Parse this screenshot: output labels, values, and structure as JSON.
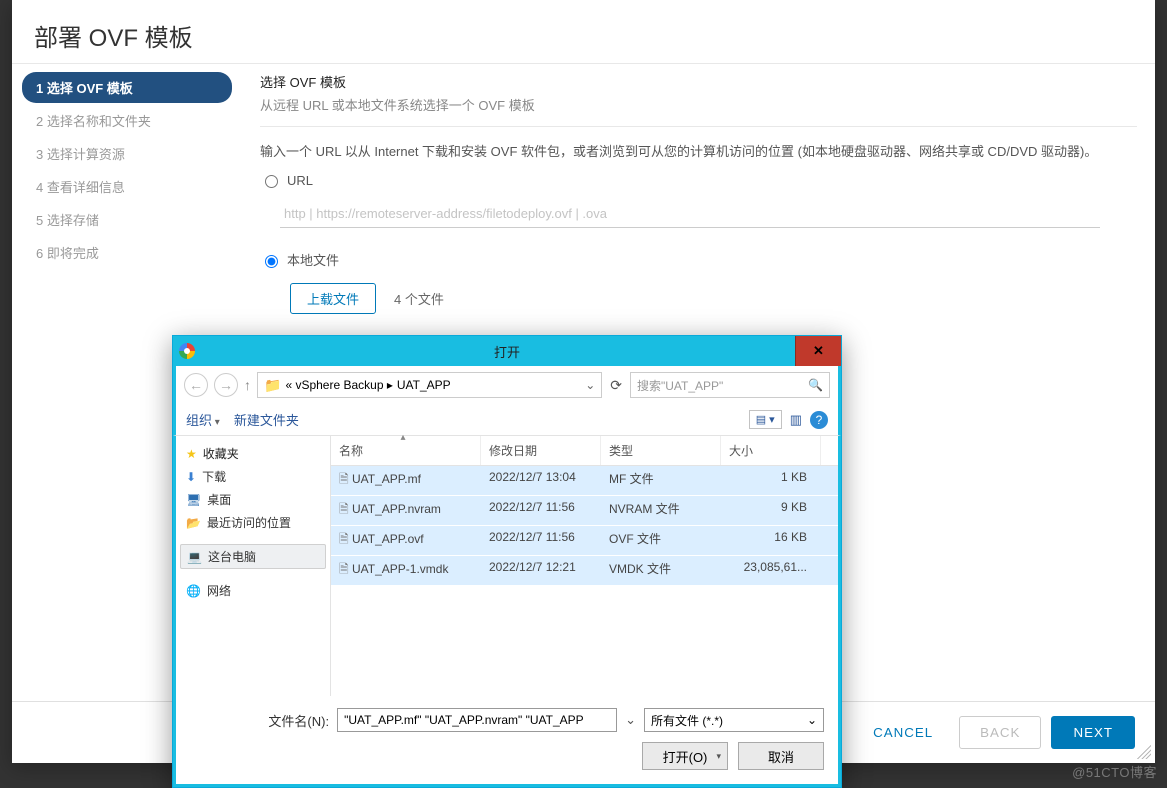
{
  "modal": {
    "title": "部署 OVF 模板",
    "steps": [
      "1 选择 OVF 模板",
      "2 选择名称和文件夹",
      "3 选择计算资源",
      "4 查看详细信息",
      "5 选择存储",
      "6 即将完成"
    ],
    "active_step_index": 0
  },
  "content": {
    "heading": "选择 OVF 模板",
    "subheading": "从远程 URL 或本地文件系统选择一个 OVF 模板",
    "hint": "输入一个 URL 以从 Internet 下载和安装 OVF 软件包，或者浏览到可从您的计算机访问的位置 (如本地硬盘驱动器、网络共享或 CD/DVD 驱动器)。",
    "url_label": "URL",
    "url_placeholder": "http | https://remoteserver-address/filetodeploy.ovf | .ova",
    "local_label": "本地文件",
    "upload_btn": "上载文件",
    "file_count": "4 个文件",
    "source_selected": "local"
  },
  "dialog": {
    "title": "打开",
    "breadcrumb_prefix": "«  vSphere Backup  ▸",
    "breadcrumb_current": "UAT_APP",
    "search_placeholder": "搜索\"UAT_APP\"",
    "toolbar": {
      "organize": "组织",
      "newfolder": "新建文件夹"
    },
    "side": {
      "favorites": "收藏夹",
      "downloads": "下载",
      "desktop": "桌面",
      "recent": "最近访问的位置",
      "thispc": "这台电脑",
      "network": "网络"
    },
    "columns": {
      "name": "名称",
      "date": "修改日期",
      "type": "类型",
      "size": "大小"
    },
    "files": [
      {
        "name": "UAT_APP.mf",
        "date": "2022/12/7 13:04",
        "type": "MF 文件",
        "size": "1 KB"
      },
      {
        "name": "UAT_APP.nvram",
        "date": "2022/12/7 11:56",
        "type": "NVRAM 文件",
        "size": "9 KB"
      },
      {
        "name": "UAT_APP.ovf",
        "date": "2022/12/7 11:56",
        "type": "OVF 文件",
        "size": "16 KB"
      },
      {
        "name": "UAT_APP-1.vmdk",
        "date": "2022/12/7 12:21",
        "type": "VMDK 文件",
        "size": "23,085,61..."
      }
    ],
    "filename_label": "文件名(N):",
    "filename_value": "\"UAT_APP.mf\" \"UAT_APP.nvram\" \"UAT_APP",
    "filter": "所有文件 (*.*)",
    "open_btn": "打开(O)",
    "cancel_btn": "取消"
  },
  "footer": {
    "cancel": "CANCEL",
    "back": "BACK",
    "next": "NEXT"
  },
  "watermark": "@51CTO博客"
}
